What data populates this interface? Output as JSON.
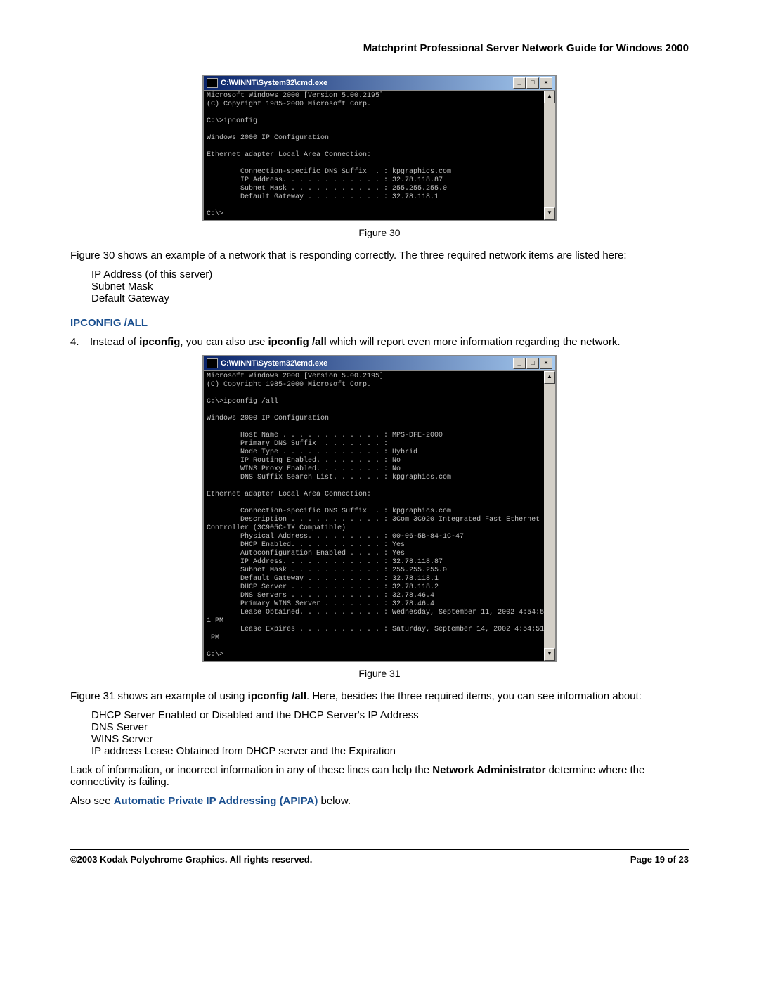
{
  "header": {
    "title": "Matchprint Professional Server Network Guide for Windows 2000"
  },
  "cmd1": {
    "title": "C:\\WINNT\\System32\\cmd.exe",
    "body": "Microsoft Windows 2000 [Version 5.00.2195]\n(C) Copyright 1985-2000 Microsoft Corp.\n\nC:\\>ipconfig\n\nWindows 2000 IP Configuration\n\nEthernet adapter Local Area Connection:\n\n        Connection-specific DNS Suffix  . : kpgraphics.com\n        IP Address. . . . . . . . . . . . : 32.78.118.87\n        Subnet Mask . . . . . . . . . . . : 255.255.255.0\n        Default Gateway . . . . . . . . . : 32.78.118.1\n\nC:\\>"
  },
  "fig1_caption": "Figure 30",
  "para1": "Figure 30 shows an example of a network that is responding correctly.  The three required network items are listed here:",
  "list1": {
    "l1": "IP Address (of this server)",
    "l2": "Subnet Mask",
    "l3": "Default Gateway"
  },
  "section1": "IPCONFIG /ALL",
  "step4": {
    "num": "4.",
    "t1": "Instead of ",
    "b1": "ipconfig",
    "t2": ", you can also use ",
    "b2": "ipconfig /all",
    "t3": " which will report even more information regarding the network."
  },
  "cmd2": {
    "title": "C:\\WINNT\\System32\\cmd.exe",
    "body": "Microsoft Windows 2000 [Version 5.00.2195]\n(C) Copyright 1985-2000 Microsoft Corp.\n\nC:\\>ipconfig /all\n\nWindows 2000 IP Configuration\n\n        Host Name . . . . . . . . . . . . : MPS-DFE-2000\n        Primary DNS Suffix  . . . . . . . :\n        Node Type . . . . . . . . . . . . : Hybrid\n        IP Routing Enabled. . . . . . . . : No\n        WINS Proxy Enabled. . . . . . . . : No\n        DNS Suffix Search List. . . . . . : kpgraphics.com\n\nEthernet adapter Local Area Connection:\n\n        Connection-specific DNS Suffix  . : kpgraphics.com\n        Description . . . . . . . . . . . : 3Com 3C920 Integrated Fast Ethernet\nController (3C905C-TX Compatible)\n        Physical Address. . . . . . . . . : 00-06-5B-84-1C-47\n        DHCP Enabled. . . . . . . . . . . : Yes\n        Autoconfiguration Enabled . . . . : Yes\n        IP Address. . . . . . . . . . . . : 32.78.118.87\n        Subnet Mask . . . . . . . . . . . : 255.255.255.0\n        Default Gateway . . . . . . . . . : 32.78.118.1\n        DHCP Server . . . . . . . . . . . : 32.78.118.2\n        DNS Servers . . . . . . . . . . . : 32.78.46.4\n        Primary WINS Server . . . . . . . : 32.78.46.4\n        Lease Obtained. . . . . . . . . . : Wednesday, September 11, 2002 4:54:5\n1 PM\n        Lease Expires . . . . . . . . . . : Saturday, September 14, 2002 4:54:51\n PM\n\nC:\\>"
  },
  "fig2_caption": "Figure 31",
  "para2a": "Figure 31 shows an example of using ",
  "para2b": "ipconfig /all",
  "para2c": ".  Here, besides the three required items, you can see information about:",
  "list2": {
    "l1": "DHCP Server Enabled or Disabled and the DHCP Server's IP Address",
    "l2": "DNS Server",
    "l3": "WINS Server",
    "l4": "IP address Lease Obtained from DHCP server and the Expiration"
  },
  "para3a": "Lack of information, or incorrect information in any of these lines can help the ",
  "para3b": "Network Administrator",
  "para3c": " determine where the connectivity is failing.",
  "para4a": "Also see ",
  "para4b": "Automatic Private IP Addressing (APIPA)",
  "para4c": " below.",
  "footer": {
    "left": "©2003 Kodak Polychrome Graphics. All rights reserved.",
    "right": "Page 19 of 23"
  }
}
